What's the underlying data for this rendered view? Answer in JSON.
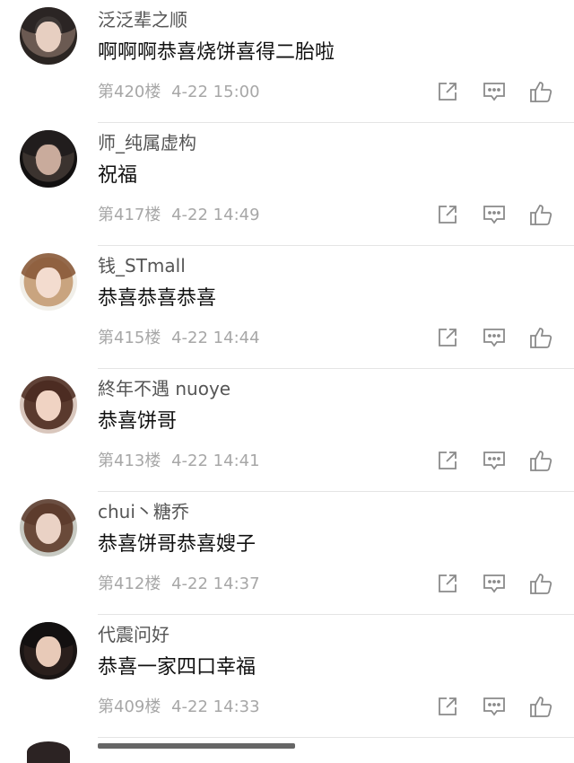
{
  "comments": [
    {
      "username": "泛泛辈之顺",
      "text": "啊啊啊恭喜烧饼喜得二胎啦",
      "floor": "第420楼",
      "time": "4-22 15:00"
    },
    {
      "username": "师_纯属虚构",
      "text": "祝福",
      "floor": "第417楼",
      "time": "4-22 14:49"
    },
    {
      "username": "钱_STmall",
      "text": "恭喜恭喜恭喜",
      "floor": "第415楼",
      "time": "4-22 14:44"
    },
    {
      "username": "終年不遇 nuoye",
      "text": "恭喜饼哥",
      "floor": "第413楼",
      "time": "4-22 14:41"
    },
    {
      "username": "chui丶糖乔",
      "text": "恭喜饼哥恭喜嫂子",
      "floor": "第412楼",
      "time": "4-22 14:37"
    },
    {
      "username": "代震问好",
      "text": "恭喜一家四口幸福",
      "floor": "第409楼",
      "time": "4-22 14:33"
    }
  ],
  "icons": {
    "share": "share-icon",
    "comment": "comment-icon",
    "like": "like-icon"
  },
  "colors": {
    "username": "#555555",
    "text": "#111111",
    "meta": "#a7a7a7",
    "icon": "#8a8a8a",
    "divider": "#e4e4e4"
  }
}
